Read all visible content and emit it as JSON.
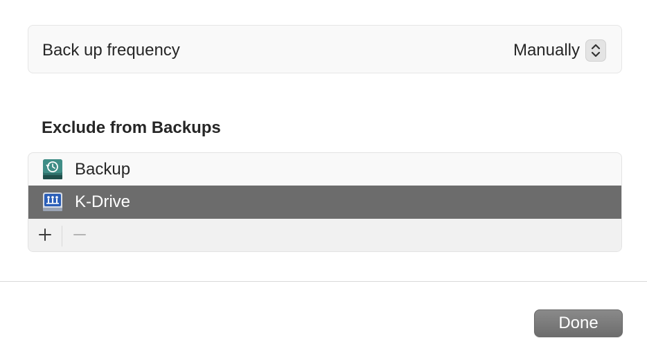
{
  "settings": {
    "frequency_label": "Back up frequency",
    "frequency_value": "Manually"
  },
  "exclusions": {
    "title": "Exclude from Backups",
    "items": [
      {
        "label": "Backup",
        "icon": "time-machine-drive-icon",
        "selected": false
      },
      {
        "label": "K-Drive",
        "icon": "network-drive-icon",
        "selected": true
      }
    ],
    "add_symbol": "+",
    "remove_symbol": "−"
  },
  "footer": {
    "done_label": "Done"
  },
  "colors": {
    "selection": "#6c6c6c",
    "panel_background": "#f9f9f9",
    "button_background": "#7b7b7b"
  }
}
